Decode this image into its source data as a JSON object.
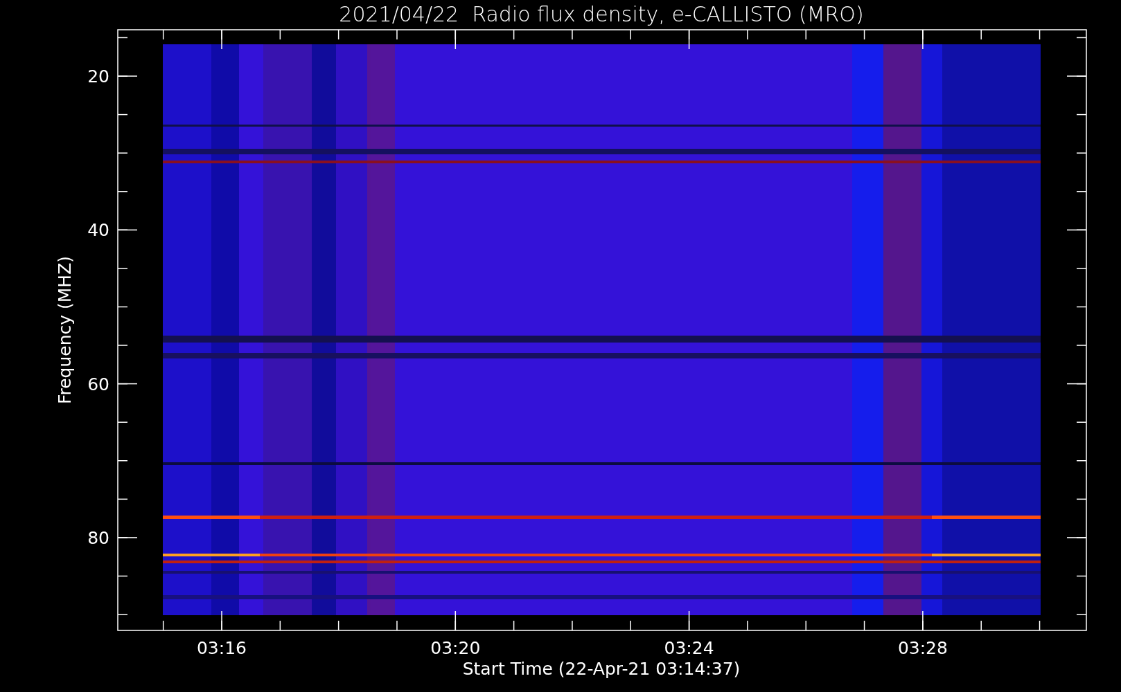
{
  "plot": {
    "title": "2021/04/22  Radio flux density, e-CALLISTO (MRO)",
    "y_axis": {
      "label": "Frequency (MHZ)",
      "ticks": [
        "20",
        "40",
        "60",
        "80"
      ]
    },
    "x_axis": {
      "label": "Start Time (22-Apr-21 03:14:37)",
      "ticks": [
        "03:16",
        "03:20",
        "03:24",
        "03:28"
      ]
    }
  }
}
